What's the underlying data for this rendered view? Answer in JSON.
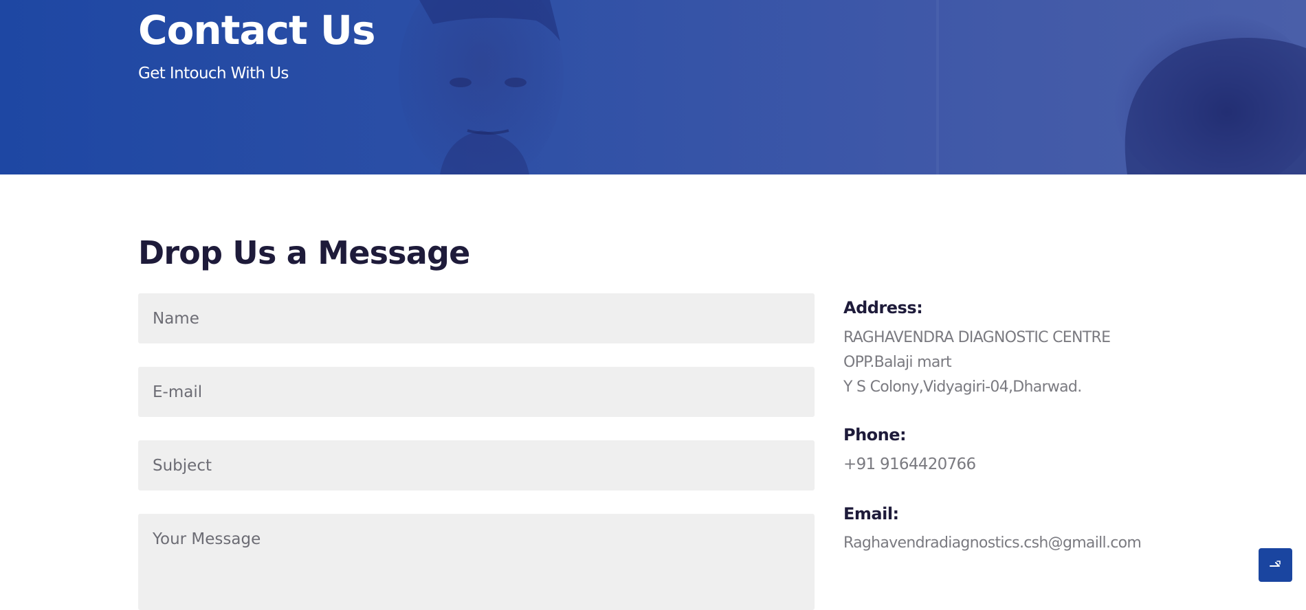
{
  "hero": {
    "title": "Contact Us",
    "subtitle": "Get Intouch With Us"
  },
  "form": {
    "heading": "Drop Us a Message",
    "name_placeholder": "Name",
    "email_placeholder": "E-mail",
    "subject_placeholder": "Subject",
    "message_placeholder": "Your Message"
  },
  "contact_info": {
    "address_label": "Address:",
    "address_line1": "RAGHAVENDRA DIAGNOSTIC CENTRE",
    "address_line2": "OPP.Balaji mart",
    "address_line3": "Y S Colony,Vidyagiri-04,Dharwad.",
    "phone_label": "Phone:",
    "phone_value": "+91 9164420766",
    "email_label": "Email:",
    "email_value": "Raghavendradiagnostics.csh@gmaill.com"
  },
  "scroll_top": {
    "icon": "arrow-up-icon"
  },
  "colors": {
    "hero_blue": "#1e47a3",
    "heading": "#1e1b3a",
    "field_bg": "#efefef",
    "info_text": "#7a7a80",
    "button_blue": "#1a45a0"
  }
}
